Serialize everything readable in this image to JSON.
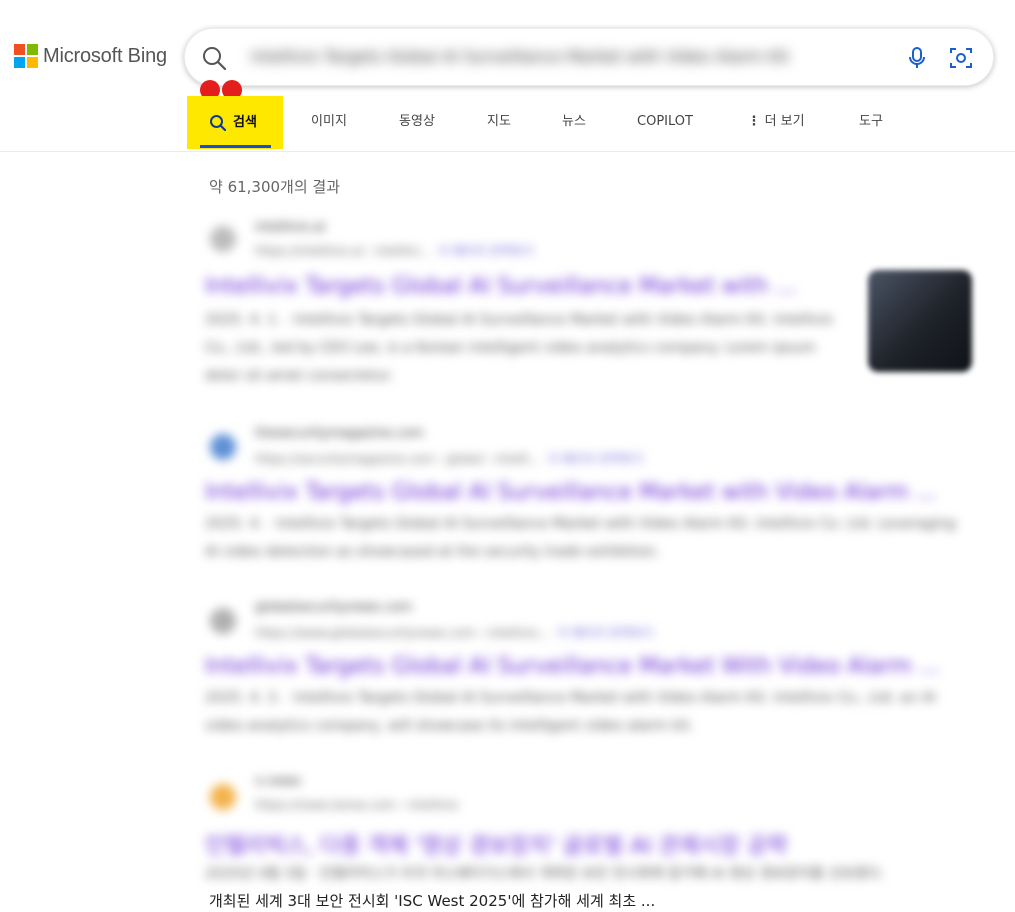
{
  "brand": {
    "name": "Microsoft Bing"
  },
  "search": {
    "query": "Intellivix Targets Global AI Surveillance Market with Video Alarm Kit"
  },
  "tabs": [
    {
      "label": "검색"
    },
    {
      "label": "이미지"
    },
    {
      "label": "동영상"
    },
    {
      "label": "지도"
    },
    {
      "label": "뉴스"
    },
    {
      "label": "COPILOT"
    },
    {
      "label": "더 보기"
    },
    {
      "label": "도구"
    }
  ],
  "result_count": "약 61,300개의 결과",
  "results": [
    {
      "site": "intellivix.ai",
      "url": "https://intellivix.ai › intellivi...",
      "translate": "이 페이지 번역하기",
      "title": "Intellivix Targets Global AI Surveillance Market with ...",
      "snippet": "2025. 4. 1. · Intellivix Targets Global AI Surveillance Market with Video Alarm Kit. Intellivix Co., Ltd., led by CEO Lee, is a Korean intelligent video analytics company. Lorem ipsum dolor sit amet consectetur."
    },
    {
      "site": "thesecuritymagazine.com",
      "url": "https://securitymagazine.com › global › intelli...",
      "translate": "이 페이지 번역하기",
      "title": "Intellivix Targets Global AI Surveillance Market with Video Alarm ...",
      "snippet": "2025. 4. · Intellivix Targets Global AI Surveillance Market with Video Alarm Kit. Intellivix Co. Ltd. Leveraging AI video detection as showcased at the security trade exhibition."
    },
    {
      "site": "globalsecuritynews.com",
      "url": "https://www.globalsecuritynews.com › intellivix...",
      "translate": "이 페이지 번역하기",
      "title": "Intellivix Targets Global AI Surveillance Market With Video Alarm ...",
      "snippet": "2025. 4. 3. · Intellivix Targets Global AI Surveillance Market with Video Alarm Kit. Intellivix Co., Ltd. an AI video analytics company, will showcase its intelligent video alarm kit."
    },
    {
      "site": "n.news",
      "url": "https://news.korea.com › intellivix",
      "translate": "",
      "title": "인텔리빅스, 다중 객체 '영상 경보장치' 글로벌 AI 관제시장 공략",
      "snippet": "2025년 4월 3일 · 인텔리빅스가 미국 라스베이거스에서 개최된 보안 전시회에 참가해 AI 영상 경보장치를 선보였다."
    }
  ],
  "visible_snippet_line": "개최된 세계 3대 보안 전시회 'ISC West 2025'에 참가해 세계 최초 ...",
  "colors": {
    "active_tab_highlight": "#ffe800",
    "active_tab_underline": "#174ae4",
    "result_title": "#6a2fd6",
    "marker_dots": "#e41d1d"
  },
  "icons": [
    "search-icon",
    "microphone-icon",
    "visual-search-icon",
    "more-vertical-icon",
    "search-tab-icon"
  ]
}
